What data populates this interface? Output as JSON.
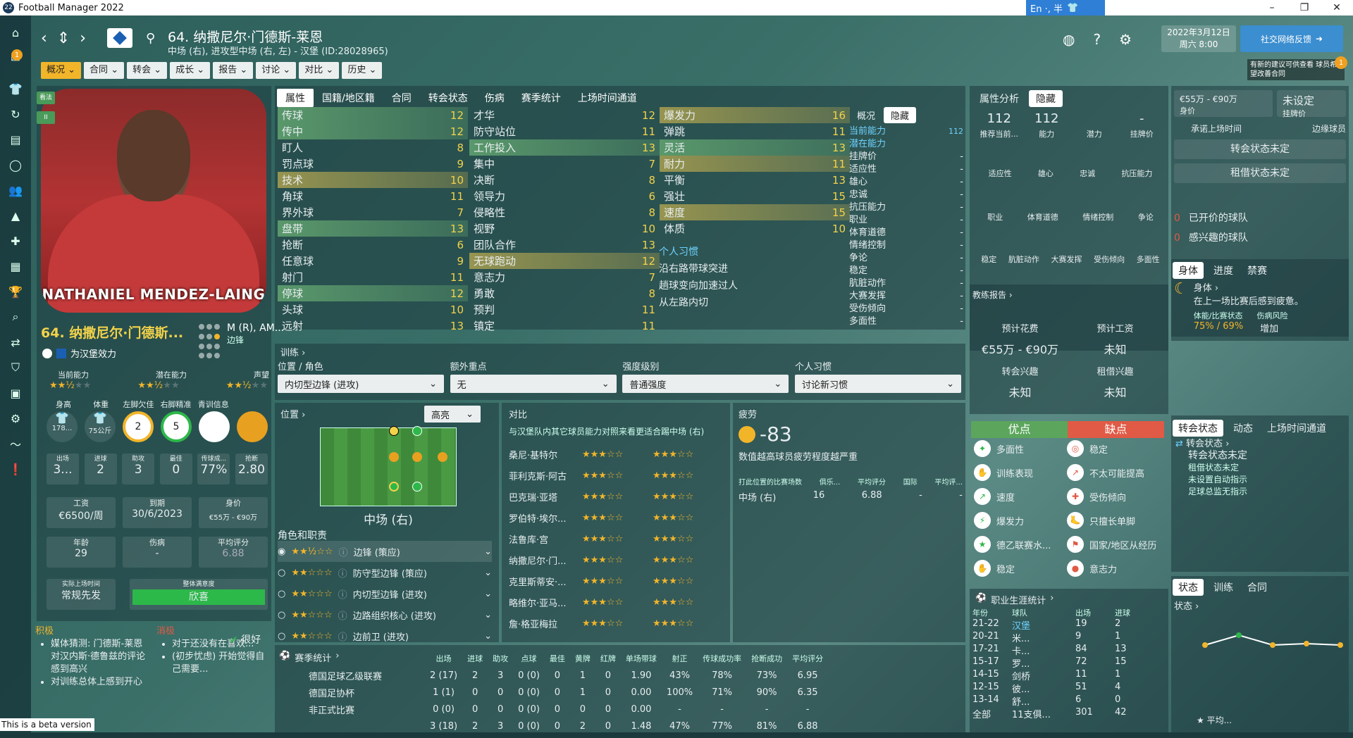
{
  "window": {
    "title": "Football Manager 2022",
    "icon": "22",
    "ime": "En ·, 半"
  },
  "header": {
    "player_title": "64. 纳撒尼尔·门德斯-莱恩",
    "player_subtitle": "中场 (右), 进攻型中场 (右, 左) - 汉堡 (ID:28028965)",
    "date_line1": "2022年3月12日",
    "date_line2": "周六 8:00",
    "social_btn": "社交网络反馈",
    "notif_text": "有新的建议可供查看 球员希望改善合同",
    "notif_count": "1",
    "help_icon": "?"
  },
  "menu": [
    "概况",
    "合同",
    "转会",
    "成长",
    "报告",
    "讨论",
    "对比",
    "历史"
  ],
  "sidebar_badge": "1",
  "left": {
    "tag1": "看法",
    "tag2": "II",
    "photo_name": "NATHANIEL MENDEZ-LAING",
    "name": "64. 纳撒尼尔·门德斯...",
    "club": "为汉堡效力",
    "pos": "M (R), AM...",
    "pos2": "边锋",
    "labels": {
      "ca": "当前能力",
      "pa": "潜在能力",
      "rep": "声望"
    },
    "stars": {
      "ca": 2.5,
      "pa": 2.5,
      "rep": 2.5
    },
    "attr_labels": [
      "身高",
      "体重",
      "左脚欠佳",
      "右脚精准",
      "青训信息",
      ""
    ],
    "height": "178...",
    "weight": "75公斤",
    "left_foot": "2",
    "right_foot": "5",
    "stats_labels": [
      "出场",
      "进球",
      "助攻",
      "最佳",
      "传球成...",
      "抢断"
    ],
    "stats_values": [
      "3...",
      "2",
      "3",
      "0",
      "77%",
      "2.80"
    ],
    "wage_label": "工资",
    "wage": "€6500/周",
    "expiry_label": "到期",
    "expiry": "30/6/2023",
    "value_label": "身价",
    "value": "€55万 - €90万",
    "age_label": "年龄",
    "age": "29",
    "injury_label": "伤病",
    "injury": "-",
    "rating_label": "平均评分",
    "rating": "6.88",
    "playtime_label": "实际上场时间",
    "playtime": "常规先发",
    "satisfaction_label": "整体满意度",
    "satisfaction": "欣喜",
    "positives_title": "积极",
    "positives": [
      "媒体猜测: 门德斯-莱恩对汉内斯·德鲁兹的评论感到高兴",
      "对训练总体上感到开心"
    ],
    "negatives_title": "消极",
    "negatives": [
      "对于还没有在喜欢...",
      "(初步忧虑) 开始觉得自己需要..."
    ],
    "mood": "很好"
  },
  "center": {
    "tabs": [
      "属性",
      "国籍/地区籍",
      "合同",
      "转会状态",
      "伤病",
      "赛季统计",
      "上场时间通道"
    ],
    "col1": [
      [
        "传球",
        "12"
      ],
      [
        "传中",
        "12"
      ],
      [
        "盯人",
        "8"
      ],
      [
        "罚点球",
        "9"
      ],
      [
        "技术",
        "10"
      ],
      [
        "角球",
        "11"
      ],
      [
        "界外球",
        "7"
      ],
      [
        "盘带",
        "13"
      ],
      [
        "抢断",
        "6"
      ],
      [
        "任意球",
        "9"
      ],
      [
        "射门",
        "11"
      ],
      [
        "停球",
        "12"
      ],
      [
        "头球",
        "10"
      ],
      [
        "远射",
        "13"
      ]
    ],
    "col2": [
      [
        "才华",
        "12"
      ],
      [
        "防守站位",
        "11"
      ],
      [
        "工作投入",
        "13"
      ],
      [
        "集中",
        "7"
      ],
      [
        "决断",
        "8"
      ],
      [
        "领导力",
        "6"
      ],
      [
        "侵略性",
        "8"
      ],
      [
        "视野",
        "10"
      ],
      [
        "团队合作",
        "13"
      ],
      [
        "无球跑动",
        "12"
      ],
      [
        "意志力",
        "7"
      ],
      [
        "勇敢",
        "8"
      ],
      [
        "预判",
        "11"
      ],
      [
        "镇定",
        "11"
      ]
    ],
    "col3": [
      [
        "爆发力",
        "16"
      ],
      [
        "弹跳",
        "11"
      ],
      [
        "灵活",
        "13"
      ],
      [
        "耐力",
        "11"
      ],
      [
        "平衡",
        "13"
      ],
      [
        "强壮",
        "15"
      ],
      [
        "速度",
        "15"
      ],
      [
        "体质",
        "10"
      ]
    ],
    "habits_title": "个人习惯",
    "habits": [
      "沿右路带球突进",
      "趟球变向加速过人",
      "从左路内切"
    ],
    "side_tabs": [
      "概况",
      "隐藏"
    ],
    "cap_list": [
      [
        "当前能力",
        "112"
      ],
      [
        "潜在能力",
        ""
      ],
      [
        "挂牌价",
        "-"
      ],
      [
        "适应性",
        "-"
      ],
      [
        "雄心",
        "-"
      ],
      [
        "忠诚",
        "-"
      ],
      [
        "抗压能力",
        "-"
      ],
      [
        "职业",
        "-"
      ],
      [
        "体育道德",
        "-"
      ],
      [
        "情绪控制",
        "-"
      ],
      [
        "争论",
        "-"
      ],
      [
        "稳定",
        "-"
      ],
      [
        "肮脏动作",
        "-"
      ],
      [
        "大赛发挥",
        "-"
      ],
      [
        "受伤倾向",
        "-"
      ],
      [
        "多面性",
        "-"
      ]
    ]
  },
  "training": {
    "title": "训练",
    "labels": [
      "位置 / 角色",
      "额外重点",
      "强度级别",
      "个人习惯"
    ],
    "values": [
      "内切型边锋 (进攻)",
      "无",
      "普通强度",
      "讨论新习惯"
    ]
  },
  "position": {
    "title": "位置",
    "highlight": "高亮",
    "current": "中场 (右)",
    "roles_title": "角色和职责",
    "roles": [
      "边锋 (策应)",
      "防守型边锋 (策应)",
      "内切型边锋 (进攻)",
      "边路组织核心 (进攻)",
      "边前卫 (进攻)"
    ]
  },
  "compare": {
    "title": "对比",
    "desc": "与汉堡队内其它球员能力对照来看更适合踢中场 (右)",
    "players": [
      "桑尼·基特尔",
      "菲利克斯·阿古",
      "巴克瑞·亚塔",
      "罗伯特·埃尔...",
      "法鲁库·宫",
      "纳撒尼尔·门...",
      "克里斯蒂安·...",
      "略维尔·亚马...",
      "詹·格亚梅拉"
    ]
  },
  "fatigue": {
    "title": "疲劳",
    "value": "-83",
    "desc": "数值越高球员疲劳程度越严重",
    "table_head": [
      "打此位置的比赛场数",
      "俱乐...",
      "平均评分",
      "国际",
      "平均评..."
    ],
    "row": [
      "中场 (右)",
      "16",
      "6.88",
      "-",
      "-"
    ]
  },
  "season": {
    "title": "赛季统计",
    "head": [
      "出场",
      "进球",
      "助攻",
      "点球",
      "最佳",
      "黄牌",
      "红牌",
      "单场带球",
      "射正",
      "传球成功率",
      "抢断成功",
      "平均评分"
    ],
    "rows": [
      [
        "德国足球乙级联赛",
        "2 (17)",
        "2",
        "3",
        "0 (0)",
        "0",
        "1",
        "0",
        "1.90",
        "43%",
        "78%",
        "73%",
        "6.95"
      ],
      [
        "德国足协杯",
        "1 (1)",
        "0",
        "0",
        "0 (0)",
        "0",
        "1",
        "0",
        "0.00",
        "100%",
        "71%",
        "90%",
        "6.35"
      ],
      [
        "非正式比赛",
        "0 (0)",
        "0",
        "0",
        "0 (0)",
        "0",
        "0",
        "0",
        "0.00",
        "-",
        "-",
        "-",
        "-"
      ],
      [
        "",
        "3 (18)",
        "2",
        "3",
        "0 (0)",
        "0",
        "2",
        "0",
        "1.48",
        "47%",
        "77%",
        "81%",
        "6.88"
      ]
    ]
  },
  "attr_analysis": {
    "tabs": [
      "属性分析",
      "隐藏"
    ],
    "top_values": [
      "112",
      "112",
      "",
      "-"
    ],
    "top_labels": [
      "推荐当前...",
      "能力",
      "潜力",
      "挂牌价"
    ],
    "row2": [
      "适应性",
      "雄心",
      "忠诚",
      "抗压能力"
    ],
    "row3": [
      "职业",
      "体育道德",
      "情绪控制",
      "争论"
    ],
    "row4": [
      "稳定",
      "肮脏动作",
      "大赛发挥",
      "受伤倾向",
      "多面性"
    ]
  },
  "scout": {
    "title": "教练报告",
    "labels": [
      "预计花费",
      "预计工资",
      "转会兴趣",
      "租借兴趣"
    ],
    "values": [
      "€55万 - €90万",
      "未知",
      "未知",
      "未知"
    ]
  },
  "pros_cons": {
    "pro_title": "优点",
    "con_title": "缺点",
    "pros": [
      "多面性",
      "训练表现",
      "速度",
      "爆发力",
      "德乙联赛水...",
      "稳定"
    ],
    "cons": [
      "稳定",
      "不太可能提高",
      "受伤倾向",
      "只擅长单脚",
      "国家/地区从经历",
      "意志力"
    ]
  },
  "career": {
    "title": "职业生涯统计",
    "head": [
      "年份",
      "球队",
      "出场",
      "进球"
    ],
    "rows": [
      [
        "21-22",
        "汉堡",
        "19",
        "2"
      ],
      [
        "20-21",
        "米...",
        "9",
        "1"
      ],
      [
        "17-21",
        "卡...",
        "84",
        "13"
      ],
      [
        "15-17",
        "罗...",
        "72",
        "15"
      ],
      [
        "14-15",
        "剑桥",
        "11",
        "1"
      ],
      [
        "12-15",
        "彼...",
        "51",
        "4"
      ],
      [
        "13-14",
        "舒...",
        "6",
        "0"
      ],
      [
        "全部",
        "11支俱...",
        "301",
        "42"
      ]
    ]
  },
  "transfer": {
    "value": "€55万 - €90万",
    "value_label": "身价",
    "asking": "未设定",
    "asking_label": "挂牌价",
    "labels": [
      "承诺上场时间",
      "边缘球员"
    ],
    "status": "转会状态未定",
    "loan": "租借状态未定",
    "offers": [
      "0",
      "0"
    ],
    "offer_labels": [
      "已开价的球队",
      "感兴趣的球队"
    ]
  },
  "body": {
    "tabs": [
      "身体",
      "进度",
      "禁赛"
    ],
    "title": "身体",
    "desc": "在上一场比赛后感到疲惫。",
    "labels": [
      "体能/比赛状态",
      "伤病风险"
    ],
    "values": [
      "75% / 69%",
      "增加"
    ]
  },
  "status_tabs": [
    "转会状态",
    "动态",
    "上场时间通道"
  ],
  "status_panel": {
    "title": "转会状态",
    "items": [
      "转会状态未定",
      "租借状态未定",
      "未设置自动指示",
      "足球总监无指示"
    ]
  },
  "form": {
    "tabs": [
      "状态",
      "训练",
      "合同"
    ],
    "title": "状态",
    "avg": "平均"
  },
  "beta": "This is a beta version",
  "colors": {
    "accent": "#f2b52a",
    "good": "#5ba65c",
    "bad": "#e05a45",
    "highlight_blue": "#6fd3ff"
  }
}
